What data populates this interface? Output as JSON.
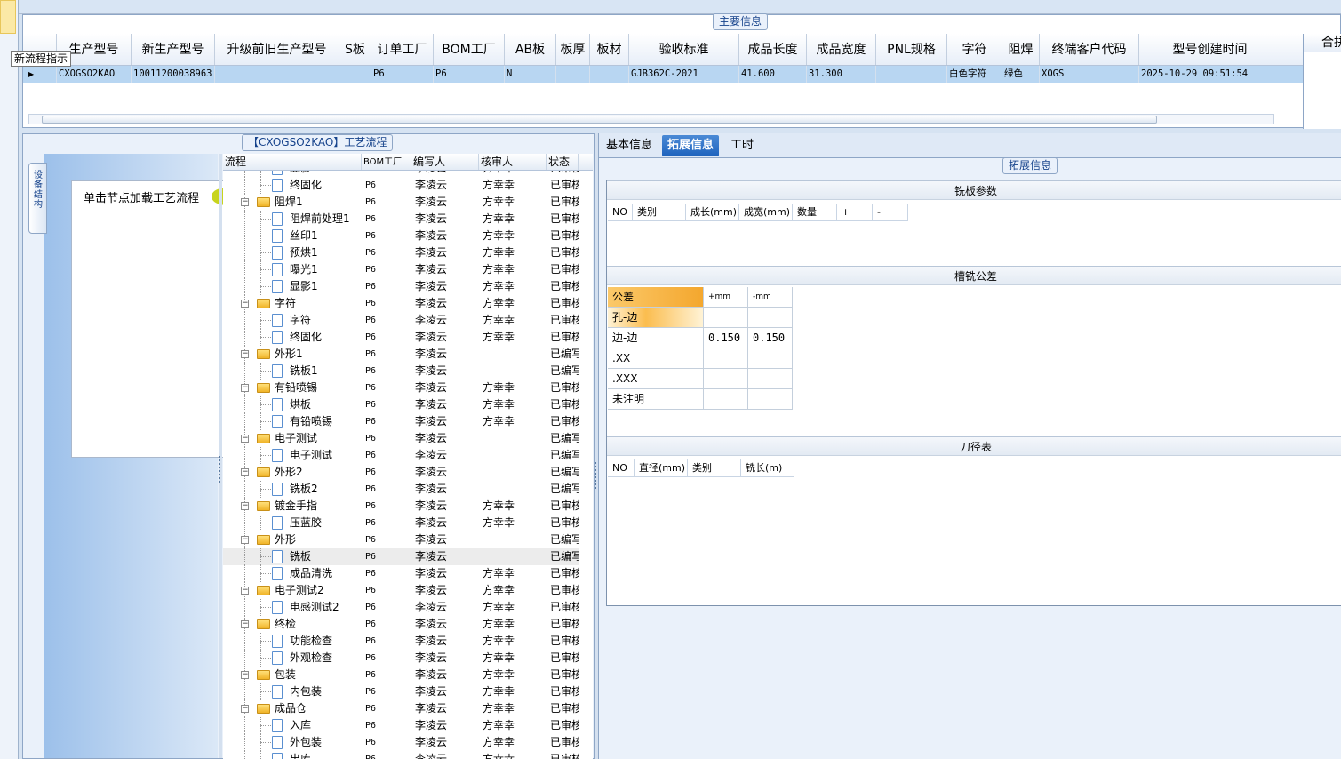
{
  "main_info": {
    "legend": "主要信息",
    "columns": [
      "生产型号",
      "新生产型号",
      "升级前旧生产型号",
      "S板",
      "订单工厂",
      "BOM工厂",
      "AB板",
      "板厚",
      "板材",
      "验收标准",
      "成品长度",
      "成品宽度",
      "PNL规格",
      "字符",
      "阻焊",
      "终端客户代码",
      "型号创建时间"
    ],
    "row": [
      "CXOGSO2KAO",
      "10011200038963",
      "",
      "",
      "P6",
      "P6",
      "N",
      "",
      "",
      "GJB362C-2021",
      "41.600",
      "31.300",
      "",
      "白色字符",
      "绿色",
      "XOGS",
      "2025-10-29 09:51:54"
    ],
    "side_header": "合拼型号"
  },
  "tooltip": "新流程指示",
  "process": {
    "legend": "【CXOGSO2KAO】工艺流程",
    "vtab_label": "设备结构",
    "node_hint": "单击节点加载工艺流程",
    "columns": [
      "流程",
      "BOM工厂",
      "编写人",
      "核审人",
      "状态"
    ],
    "rows": [
      {
        "name": "显影",
        "level": 2,
        "bom": "P6",
        "writer": "李凌云",
        "reviewer": "方幸幸",
        "status": "已审核",
        "cut": true
      },
      {
        "name": "终固化",
        "level": 2,
        "bom": "P6",
        "writer": "李凌云",
        "reviewer": "方幸幸",
        "status": "已审核"
      },
      {
        "name": "阻焊1",
        "level": 1,
        "bom": "P6",
        "writer": "李凌云",
        "reviewer": "方幸幸",
        "status": "已审核"
      },
      {
        "name": "阻焊前处理1",
        "level": 2,
        "bom": "P6",
        "writer": "李凌云",
        "reviewer": "方幸幸",
        "status": "已审核"
      },
      {
        "name": "丝印1",
        "level": 2,
        "bom": "P6",
        "writer": "李凌云",
        "reviewer": "方幸幸",
        "status": "已审核"
      },
      {
        "name": "预烘1",
        "level": 2,
        "bom": "P6",
        "writer": "李凌云",
        "reviewer": "方幸幸",
        "status": "已审核"
      },
      {
        "name": "曝光1",
        "level": 2,
        "bom": "P6",
        "writer": "李凌云",
        "reviewer": "方幸幸",
        "status": "已审核"
      },
      {
        "name": "显影1",
        "level": 2,
        "bom": "P6",
        "writer": "李凌云",
        "reviewer": "方幸幸",
        "status": "已审核"
      },
      {
        "name": "字符",
        "level": 1,
        "bom": "P6",
        "writer": "李凌云",
        "reviewer": "方幸幸",
        "status": "已审核"
      },
      {
        "name": "字符",
        "level": 2,
        "bom": "P6",
        "writer": "李凌云",
        "reviewer": "方幸幸",
        "status": "已审核"
      },
      {
        "name": "终固化",
        "level": 2,
        "bom": "P6",
        "writer": "李凌云",
        "reviewer": "方幸幸",
        "status": "已审核"
      },
      {
        "name": "外形1",
        "level": 1,
        "bom": "P6",
        "writer": "李凌云",
        "reviewer": "",
        "status": "已编写"
      },
      {
        "name": "铣板1",
        "level": 2,
        "bom": "P6",
        "writer": "李凌云",
        "reviewer": "",
        "status": "已编写"
      },
      {
        "name": "有铅喷锡",
        "level": 1,
        "bom": "P6",
        "writer": "李凌云",
        "reviewer": "方幸幸",
        "status": "已审核"
      },
      {
        "name": "烘板",
        "level": 2,
        "bom": "P6",
        "writer": "李凌云",
        "reviewer": "方幸幸",
        "status": "已审核"
      },
      {
        "name": "有铅喷锡",
        "level": 2,
        "bom": "P6",
        "writer": "李凌云",
        "reviewer": "方幸幸",
        "status": "已审核"
      },
      {
        "name": "电子测试",
        "level": 1,
        "bom": "P6",
        "writer": "李凌云",
        "reviewer": "",
        "status": "已编写"
      },
      {
        "name": "电子测试",
        "level": 2,
        "bom": "P6",
        "writer": "李凌云",
        "reviewer": "",
        "status": "已编写"
      },
      {
        "name": "外形2",
        "level": 1,
        "bom": "P6",
        "writer": "李凌云",
        "reviewer": "",
        "status": "已编写"
      },
      {
        "name": "铣板2",
        "level": 2,
        "bom": "P6",
        "writer": "李凌云",
        "reviewer": "",
        "status": "已编写"
      },
      {
        "name": "镀金手指",
        "level": 1,
        "bom": "P6",
        "writer": "李凌云",
        "reviewer": "方幸幸",
        "status": "已审核"
      },
      {
        "name": "压蓝胶",
        "level": 2,
        "bom": "P6",
        "writer": "李凌云",
        "reviewer": "方幸幸",
        "status": "已审核"
      },
      {
        "name": "外形",
        "level": 1,
        "bom": "P6",
        "writer": "李凌云",
        "reviewer": "",
        "status": "已编写"
      },
      {
        "name": "铣板",
        "level": 2,
        "bom": "P6",
        "writer": "李凌云",
        "reviewer": "",
        "status": "已编写",
        "selected": true
      },
      {
        "name": "成品清洗",
        "level": 2,
        "bom": "P6",
        "writer": "李凌云",
        "reviewer": "方幸幸",
        "status": "已审核"
      },
      {
        "name": "电子测试2",
        "level": 1,
        "bom": "P6",
        "writer": "李凌云",
        "reviewer": "方幸幸",
        "status": "已审核"
      },
      {
        "name": "电感测试2",
        "level": 2,
        "bom": "P6",
        "writer": "李凌云",
        "reviewer": "方幸幸",
        "status": "已审核"
      },
      {
        "name": "终检",
        "level": 1,
        "bom": "P6",
        "writer": "李凌云",
        "reviewer": "方幸幸",
        "status": "已审核"
      },
      {
        "name": "功能检查",
        "level": 2,
        "bom": "P6",
        "writer": "李凌云",
        "reviewer": "方幸幸",
        "status": "已审核"
      },
      {
        "name": "外观检查",
        "level": 2,
        "bom": "P6",
        "writer": "李凌云",
        "reviewer": "方幸幸",
        "status": "已审核"
      },
      {
        "name": "包装",
        "level": 1,
        "bom": "P6",
        "writer": "李凌云",
        "reviewer": "方幸幸",
        "status": "已审核"
      },
      {
        "name": "内包装",
        "level": 2,
        "bom": "P6",
        "writer": "李凌云",
        "reviewer": "方幸幸",
        "status": "已审核"
      },
      {
        "name": "成品仓",
        "level": 1,
        "bom": "P6",
        "writer": "李凌云",
        "reviewer": "方幸幸",
        "status": "已审核"
      },
      {
        "name": "入库",
        "level": 2,
        "bom": "P6",
        "writer": "李凌云",
        "reviewer": "方幸幸",
        "status": "已审核"
      },
      {
        "name": "外包装",
        "level": 2,
        "bom": "P6",
        "writer": "李凌云",
        "reviewer": "方幸幸",
        "status": "已审核"
      },
      {
        "name": "出库",
        "level": 2,
        "bom": "P6",
        "writer": "李凌云",
        "reviewer": "方幸幸",
        "status": "已审核"
      }
    ]
  },
  "tabs": [
    "基本信息",
    "拓展信息",
    "工时"
  ],
  "active_tab": "拓展信息",
  "ext": {
    "legend": "拓展信息",
    "mill_params": {
      "title": "铣板参数",
      "columns": [
        "NO",
        "类别",
        "成长(mm)",
        "成宽(mm)",
        "数量",
        "+",
        "-"
      ]
    },
    "tolerance": {
      "title": "槽铣公差",
      "header": [
        "公差",
        "+mm",
        "-mm"
      ],
      "rows": [
        [
          "孔-边",
          "",
          ""
        ],
        [
          "边-边",
          "0.150",
          "0.150"
        ],
        [
          ".XX",
          "",
          ""
        ],
        [
          ".XXX",
          "",
          ""
        ],
        [
          "未注明",
          "",
          ""
        ]
      ]
    },
    "tool_table": {
      "title": "刀径表",
      "columns": [
        "NO",
        "直径(mm)",
        "类别",
        "铣长(m)"
      ]
    }
  },
  "colors": {
    "accent": "#1e63bd",
    "selected_row": "#b8d6f2",
    "highlight": "#f4a72e"
  }
}
